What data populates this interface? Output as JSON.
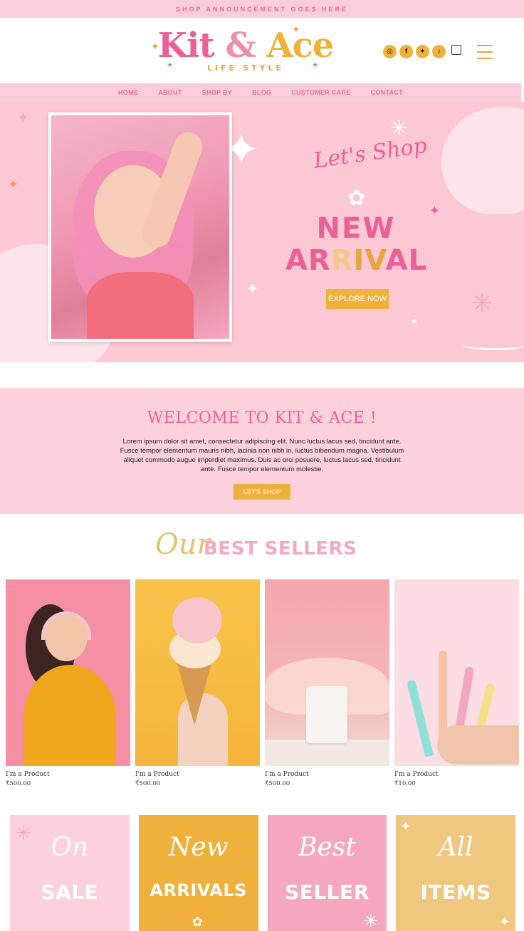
{
  "announcement": "SHOP ANNOUNCEMENT GOES HERE",
  "logo": {
    "line1_a": "Kit",
    "line1_amp": "&",
    "line1_b": "Ace",
    "tagline": "LIFE STYLE"
  },
  "social": [
    {
      "name": "instagram-icon",
      "glyph": "◎"
    },
    {
      "name": "facebook-icon",
      "glyph": "f"
    },
    {
      "name": "twitter-icon",
      "glyph": "✦"
    },
    {
      "name": "tiktok-icon",
      "glyph": "♪"
    }
  ],
  "nav": [
    "HOME",
    "ABOUT",
    "SHOP BY",
    "BLOG",
    "CUSTOMER CARE",
    "CONTACT"
  ],
  "hero": {
    "script": "Let's Shop",
    "line1": "NEW",
    "line2_parts": [
      "A",
      "R",
      "R",
      "I",
      "V",
      "A",
      "L"
    ],
    "cta": "EXPLORE NOW"
  },
  "welcome": {
    "title": "WELCOME TO KIT & ACE !",
    "body": "Lorem ipsum dolor sit amet, consectetur adipiscing elit. Nunc luctus lacus sed, tincidunt ante. Fusce tempor elementum mauris nibh, lacinia non nibh in, luctus bibendum magna. Vestibulum aliquet commodo augue imperdiet maximus. Duis ac orci posuere, luctus lacus sed, tincidunt ante. Fusce tempor elementum molestie.",
    "cta": "LET'S SHOP"
  },
  "best_sellers": {
    "script": "Our",
    "title": "BEST SELLERS"
  },
  "products": [
    {
      "name": "I'm a Product",
      "price": "₹500.00"
    },
    {
      "name": "I'm a Product",
      "price": "₹500.00"
    },
    {
      "name": "I'm a Product",
      "price": "₹500.00"
    },
    {
      "name": "I'm a Product",
      "price": "₹10.00"
    }
  ],
  "categories": [
    {
      "script": "On",
      "big": "SALE"
    },
    {
      "script": "New",
      "big": "ARRIVALS"
    },
    {
      "script": "Best",
      "big": "SELLER"
    },
    {
      "script": "All",
      "big": "ITEMS"
    }
  ],
  "colors": {
    "pink": "#ec5f97",
    "light_pink": "#fcc8d4",
    "gold": "#efb13c"
  }
}
